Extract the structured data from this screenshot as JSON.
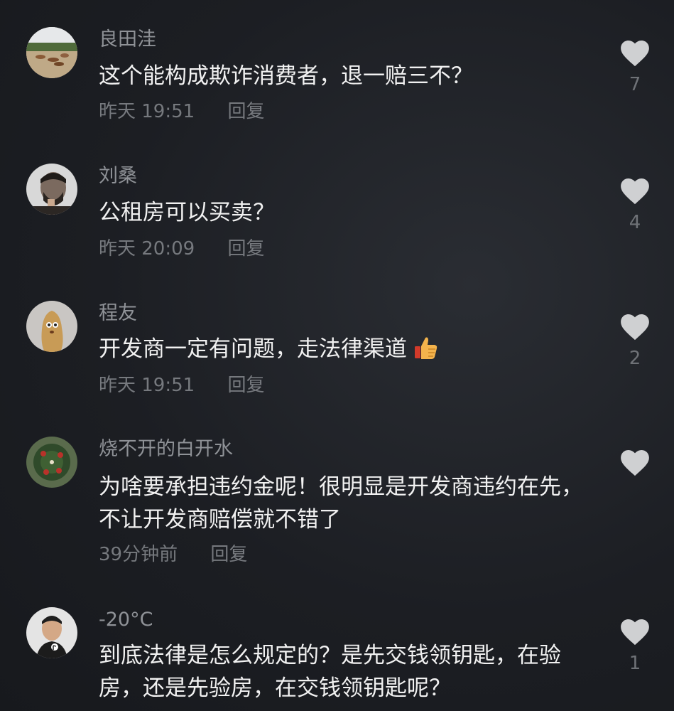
{
  "comments": [
    {
      "username": "良田洼",
      "text": "这个能构成欺诈消费者，退一赔三不？",
      "time": "昨天 19:51",
      "reply_label": "回复",
      "likes": "7"
    },
    {
      "username": "刘桑",
      "text": "公租房可以买卖？",
      "time": "昨天 20:09",
      "reply_label": "回复",
      "likes": "4"
    },
    {
      "username": "程友",
      "text": "开发商一定有问题，走法律渠道",
      "emoji": "thumbs-up",
      "time": "昨天 19:51",
      "reply_label": "回复",
      "likes": "2"
    },
    {
      "username": "烧不开的白开水",
      "text": "为啥要承担违约金呢！很明显是开发商违约在先，不让开发商赔偿就不错了",
      "time": "39分钟前",
      "reply_label": "回复",
      "likes": ""
    },
    {
      "username": "-20°C",
      "text": "到底法律是怎么规定的？是先交钱领钥匙，在验房，还是先验房，在交钱领钥匙呢？",
      "time": "",
      "reply_label": "",
      "likes": "1"
    }
  ],
  "colors": {
    "background": "#1d1f24",
    "username": "#8f9297",
    "text": "#f1f1f1",
    "meta": "#76797e",
    "heart": "#cfd0d2"
  }
}
